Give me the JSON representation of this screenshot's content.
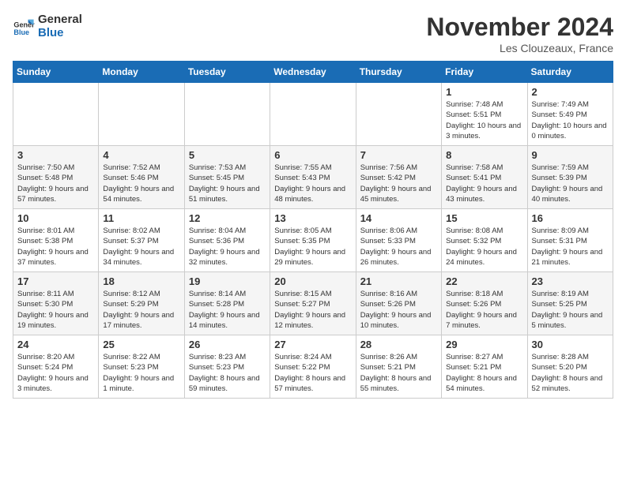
{
  "logo": {
    "line1": "General",
    "line2": "Blue"
  },
  "title": "November 2024",
  "location": "Les Clouzeaux, France",
  "days_header": [
    "Sunday",
    "Monday",
    "Tuesday",
    "Wednesday",
    "Thursday",
    "Friday",
    "Saturday"
  ],
  "weeks": [
    [
      {
        "day": "",
        "info": ""
      },
      {
        "day": "",
        "info": ""
      },
      {
        "day": "",
        "info": ""
      },
      {
        "day": "",
        "info": ""
      },
      {
        "day": "",
        "info": ""
      },
      {
        "day": "1",
        "info": "Sunrise: 7:48 AM\nSunset: 5:51 PM\nDaylight: 10 hours and 3 minutes."
      },
      {
        "day": "2",
        "info": "Sunrise: 7:49 AM\nSunset: 5:49 PM\nDaylight: 10 hours and 0 minutes."
      }
    ],
    [
      {
        "day": "3",
        "info": "Sunrise: 7:50 AM\nSunset: 5:48 PM\nDaylight: 9 hours and 57 minutes."
      },
      {
        "day": "4",
        "info": "Sunrise: 7:52 AM\nSunset: 5:46 PM\nDaylight: 9 hours and 54 minutes."
      },
      {
        "day": "5",
        "info": "Sunrise: 7:53 AM\nSunset: 5:45 PM\nDaylight: 9 hours and 51 minutes."
      },
      {
        "day": "6",
        "info": "Sunrise: 7:55 AM\nSunset: 5:43 PM\nDaylight: 9 hours and 48 minutes."
      },
      {
        "day": "7",
        "info": "Sunrise: 7:56 AM\nSunset: 5:42 PM\nDaylight: 9 hours and 45 minutes."
      },
      {
        "day": "8",
        "info": "Sunrise: 7:58 AM\nSunset: 5:41 PM\nDaylight: 9 hours and 43 minutes."
      },
      {
        "day": "9",
        "info": "Sunrise: 7:59 AM\nSunset: 5:39 PM\nDaylight: 9 hours and 40 minutes."
      }
    ],
    [
      {
        "day": "10",
        "info": "Sunrise: 8:01 AM\nSunset: 5:38 PM\nDaylight: 9 hours and 37 minutes."
      },
      {
        "day": "11",
        "info": "Sunrise: 8:02 AM\nSunset: 5:37 PM\nDaylight: 9 hours and 34 minutes."
      },
      {
        "day": "12",
        "info": "Sunrise: 8:04 AM\nSunset: 5:36 PM\nDaylight: 9 hours and 32 minutes."
      },
      {
        "day": "13",
        "info": "Sunrise: 8:05 AM\nSunset: 5:35 PM\nDaylight: 9 hours and 29 minutes."
      },
      {
        "day": "14",
        "info": "Sunrise: 8:06 AM\nSunset: 5:33 PM\nDaylight: 9 hours and 26 minutes."
      },
      {
        "day": "15",
        "info": "Sunrise: 8:08 AM\nSunset: 5:32 PM\nDaylight: 9 hours and 24 minutes."
      },
      {
        "day": "16",
        "info": "Sunrise: 8:09 AM\nSunset: 5:31 PM\nDaylight: 9 hours and 21 minutes."
      }
    ],
    [
      {
        "day": "17",
        "info": "Sunrise: 8:11 AM\nSunset: 5:30 PM\nDaylight: 9 hours and 19 minutes."
      },
      {
        "day": "18",
        "info": "Sunrise: 8:12 AM\nSunset: 5:29 PM\nDaylight: 9 hours and 17 minutes."
      },
      {
        "day": "19",
        "info": "Sunrise: 8:14 AM\nSunset: 5:28 PM\nDaylight: 9 hours and 14 minutes."
      },
      {
        "day": "20",
        "info": "Sunrise: 8:15 AM\nSunset: 5:27 PM\nDaylight: 9 hours and 12 minutes."
      },
      {
        "day": "21",
        "info": "Sunrise: 8:16 AM\nSunset: 5:26 PM\nDaylight: 9 hours and 10 minutes."
      },
      {
        "day": "22",
        "info": "Sunrise: 8:18 AM\nSunset: 5:26 PM\nDaylight: 9 hours and 7 minutes."
      },
      {
        "day": "23",
        "info": "Sunrise: 8:19 AM\nSunset: 5:25 PM\nDaylight: 9 hours and 5 minutes."
      }
    ],
    [
      {
        "day": "24",
        "info": "Sunrise: 8:20 AM\nSunset: 5:24 PM\nDaylight: 9 hours and 3 minutes."
      },
      {
        "day": "25",
        "info": "Sunrise: 8:22 AM\nSunset: 5:23 PM\nDaylight: 9 hours and 1 minute."
      },
      {
        "day": "26",
        "info": "Sunrise: 8:23 AM\nSunset: 5:23 PM\nDaylight: 8 hours and 59 minutes."
      },
      {
        "day": "27",
        "info": "Sunrise: 8:24 AM\nSunset: 5:22 PM\nDaylight: 8 hours and 57 minutes."
      },
      {
        "day": "28",
        "info": "Sunrise: 8:26 AM\nSunset: 5:21 PM\nDaylight: 8 hours and 55 minutes."
      },
      {
        "day": "29",
        "info": "Sunrise: 8:27 AM\nSunset: 5:21 PM\nDaylight: 8 hours and 54 minutes."
      },
      {
        "day": "30",
        "info": "Sunrise: 8:28 AM\nSunset: 5:20 PM\nDaylight: 8 hours and 52 minutes."
      }
    ]
  ]
}
